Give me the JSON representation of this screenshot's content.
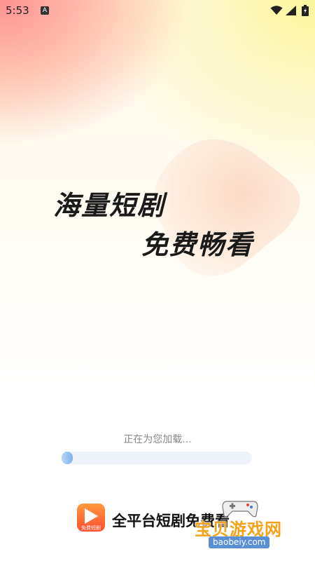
{
  "status_bar": {
    "time": "5:53",
    "notification_icon": "a-icon",
    "icons": [
      "wifi-icon",
      "signal-icon",
      "battery-icon"
    ]
  },
  "headline": {
    "line1": "海量短剧",
    "line2": "免费畅看"
  },
  "loading": {
    "text": "正在为您加载...",
    "progress": 0.05
  },
  "footer": {
    "logo_text": "免费短剧",
    "slogan": "全平台短剧免费看"
  },
  "watermark": {
    "title": "宝贝游戏网",
    "url": "baobeiy.com"
  },
  "colors": {
    "progress_fill": "#7fb2ea",
    "progress_track": "#eef3fa",
    "logo_gradient_top": "#ff9a3c",
    "logo_gradient_bottom": "#ff4d2e",
    "watermark_text": "#f3a21a"
  }
}
